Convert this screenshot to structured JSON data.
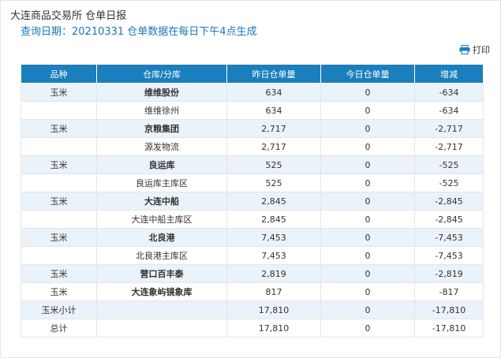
{
  "header": {
    "title": "大连商品交易所 仓单日报",
    "subtitle": "查询日期：20210331 仓单数据在每日下午4点生成",
    "print_label": "打印"
  },
  "table": {
    "columns": [
      "品种",
      "仓库/分库",
      "昨日仓单量",
      "今日仓单量",
      "增减"
    ],
    "rows": [
      {
        "variety": "玉米",
        "warehouse": "维维股份",
        "yesterday": "634",
        "today": "0",
        "change": "-634",
        "bold": true
      },
      {
        "variety": "",
        "warehouse": "维维徐州",
        "yesterday": "634",
        "today": "0",
        "change": "-634",
        "bold": false
      },
      {
        "variety": "玉米",
        "warehouse": "京粮集团",
        "yesterday": "2,717",
        "today": "0",
        "change": "-2,717",
        "bold": true
      },
      {
        "variety": "",
        "warehouse": "源发物流",
        "yesterday": "2,717",
        "today": "0",
        "change": "-2,717",
        "bold": false
      },
      {
        "variety": "玉米",
        "warehouse": "良运库",
        "yesterday": "525",
        "today": "0",
        "change": "-525",
        "bold": true
      },
      {
        "variety": "",
        "warehouse": "良运库主库区",
        "yesterday": "525",
        "today": "0",
        "change": "-525",
        "bold": false
      },
      {
        "variety": "玉米",
        "warehouse": "大连中船",
        "yesterday": "2,845",
        "today": "0",
        "change": "-2,845",
        "bold": true
      },
      {
        "variety": "",
        "warehouse": "大连中船主库区",
        "yesterday": "2,845",
        "today": "0",
        "change": "-2,845",
        "bold": false
      },
      {
        "variety": "玉米",
        "warehouse": "北良港",
        "yesterday": "7,453",
        "today": "0",
        "change": "-7,453",
        "bold": true
      },
      {
        "variety": "",
        "warehouse": "北良港主库区",
        "yesterday": "7,453",
        "today": "0",
        "change": "-7,453",
        "bold": false
      },
      {
        "variety": "玉米",
        "warehouse": "营口百丰泰",
        "yesterday": "2,819",
        "today": "0",
        "change": "-2,819",
        "bold": true
      },
      {
        "variety": "玉米",
        "warehouse": "大连象屿镜象库",
        "yesterday": "817",
        "today": "0",
        "change": "-817",
        "bold": true
      },
      {
        "variety": "玉米小计",
        "warehouse": "",
        "yesterday": "17,810",
        "today": "0",
        "change": "-17,810",
        "bold": false
      },
      {
        "variety": "总计",
        "warehouse": "",
        "yesterday": "17,810",
        "today": "0",
        "change": "-17,810",
        "bold": false
      }
    ]
  },
  "colors": {
    "header_bg": "#1a7fbc",
    "row_shade": "#eaf2fa",
    "subtitle": "#1a77bd"
  }
}
